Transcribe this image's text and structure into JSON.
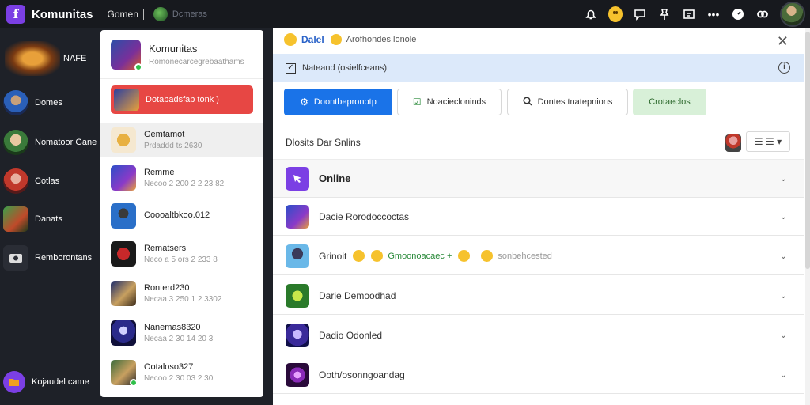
{
  "topbar": {
    "app_title": "Komunitas",
    "tab_label": "Gomen",
    "tab_sub": "Dcmeras",
    "icons": [
      "bell-icon",
      "emoji-icon",
      "chat-icon",
      "pin-icon",
      "message-icon",
      "more-icon",
      "clock-icon",
      "link-icon"
    ],
    "more_label": "•••"
  },
  "left_sidebar": {
    "featured_label": "NAFE",
    "items": [
      {
        "label": "Domes"
      },
      {
        "label": "Nomatoor Gane"
      },
      {
        "label": "Cotlas"
      },
      {
        "label": "Danats"
      },
      {
        "label": "Remborontans"
      },
      {
        "label": "Kojaudel came"
      }
    ]
  },
  "mid_panel": {
    "head_title": "Komunitas",
    "head_sub": "Romonecarcegrebaathams",
    "red_item": "Dotabadsfab tonk )",
    "rows": [
      {
        "title": "Gemtamot",
        "sub": "Prdaddd ts 2630"
      },
      {
        "title": "Remme",
        "sub": "Necoo 2 200 2 2 23 82"
      },
      {
        "title": "Coooaltbkoo.012",
        "sub": ""
      },
      {
        "title": "Rematsers",
        "sub": "Neco a 5 ors 2 233 8"
      },
      {
        "title": "Ronterd230",
        "sub": "Necaa 3 250 1 2 3302"
      },
      {
        "title": "Nanemas8320",
        "sub": "Necaa 2 30 14 20 3"
      },
      {
        "title": "Ootaloso327",
        "sub": "Necoo 2 30 03 2 30"
      }
    ]
  },
  "main": {
    "notif_name": "Dalel",
    "notif_text": "Arofhondes lonole",
    "close_label": "✕",
    "info_text": "Nateand (osielfceans)",
    "info_icon": "i",
    "buttons": {
      "primary": "Doontbepronotp",
      "outline1": "Noaciecloninds",
      "outline2": "Dontes tnatepnions",
      "green": "Crotaeclos"
    },
    "section_title": "Dlosits Dar Snlins",
    "menu_label": "☰ ☰ ▾",
    "groups": [
      {
        "label": "Online"
      },
      {
        "label": "Dacie Rorodoccoctas"
      },
      {
        "label": "Grinoit",
        "extra_green": "Gmoonoacaec +",
        "extra_grey": "sonbehcested"
      },
      {
        "label": "Darie Demoodhad"
      },
      {
        "label": "Dadio Odonled"
      },
      {
        "label": "Ooth/osonngoandag"
      }
    ],
    "chevron": "⌄"
  }
}
